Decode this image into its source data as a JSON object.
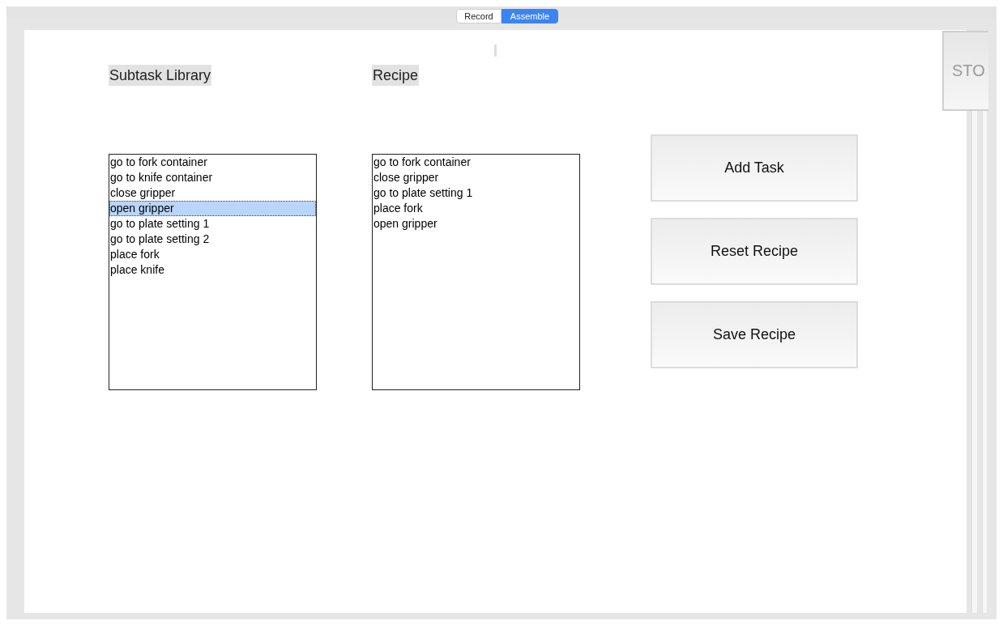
{
  "tabs": [
    {
      "label": "Record",
      "selected": false
    },
    {
      "label": "Assemble",
      "selected": true
    }
  ],
  "library": {
    "heading": "Subtask Library",
    "items": [
      {
        "label": "go to fork container",
        "selected": false
      },
      {
        "label": "go to knife container",
        "selected": false
      },
      {
        "label": "close gripper",
        "selected": false
      },
      {
        "label": "open gripper",
        "selected": true
      },
      {
        "label": "go to plate setting 1",
        "selected": false
      },
      {
        "label": "go to plate setting 2",
        "selected": false
      },
      {
        "label": "place fork",
        "selected": false
      },
      {
        "label": "place knife",
        "selected": false
      }
    ]
  },
  "recipe": {
    "heading": "Recipe",
    "items": [
      {
        "label": "go to fork container",
        "selected": false
      },
      {
        "label": "close gripper",
        "selected": false
      },
      {
        "label": "go to plate setting 1",
        "selected": false
      },
      {
        "label": "place fork",
        "selected": false
      },
      {
        "label": "open gripper",
        "selected": false
      }
    ]
  },
  "buttons": [
    "Add Task",
    "Reset Recipe",
    "Save Recipe"
  ],
  "stop_button": "STO"
}
